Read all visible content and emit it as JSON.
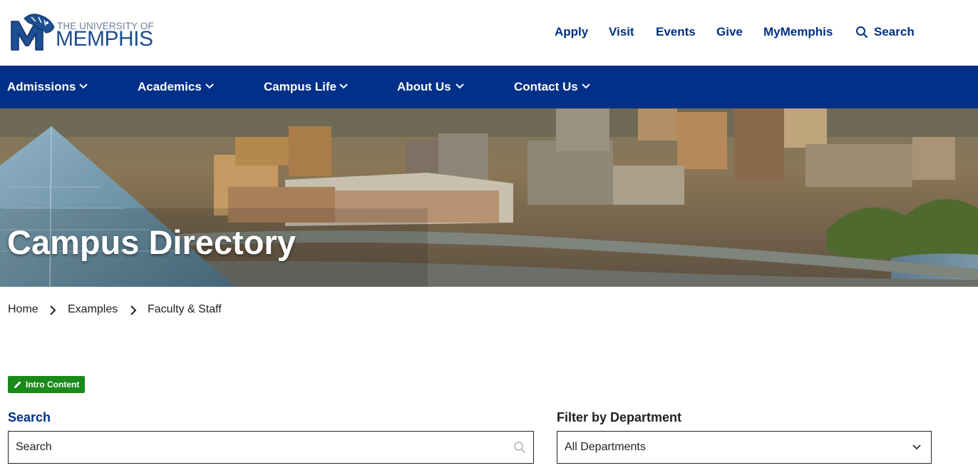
{
  "logo": {
    "line1": "THE UNIVERSITY OF",
    "line2": "MEMPHIS"
  },
  "utility_nav": {
    "links": [
      "Apply",
      "Visit",
      "Events",
      "Give",
      "MyMemphis"
    ],
    "search_label": "Search"
  },
  "main_nav": {
    "items": [
      "Admissions",
      "Academics",
      "Campus Life",
      "About Us",
      "Contact Us"
    ]
  },
  "hero": {
    "title": "Campus Directory"
  },
  "breadcrumb": {
    "items": [
      "Home",
      "Examples",
      "Faculty & Staff"
    ]
  },
  "intro_badge": {
    "label": "Intro Content"
  },
  "search": {
    "label": "Search",
    "placeholder": "Search"
  },
  "filter": {
    "label": "Filter by Department",
    "selected": "All Departments"
  },
  "colors": {
    "brand_blue": "#003087",
    "badge_green": "#1a8a1a"
  }
}
